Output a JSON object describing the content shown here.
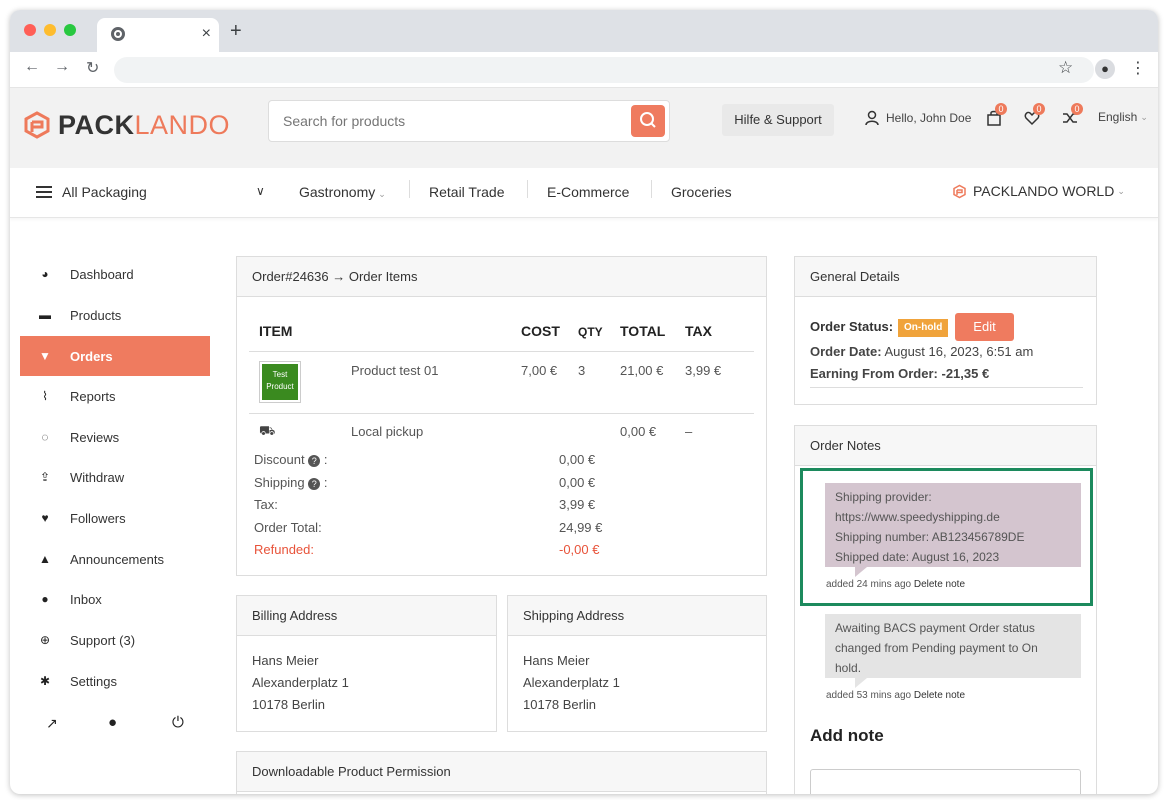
{
  "browser": {
    "new_tab": "+",
    "close_tab": "×"
  },
  "header": {
    "logo_bold": "PACK",
    "logo_light": "LANDO",
    "search_placeholder": "Search for products",
    "help_label": "Hilfe & Support",
    "greeting": "Hello, John Doe",
    "cart_count": "0",
    "wishlist_count": "0",
    "compare_count": "0",
    "language": "English"
  },
  "categories": {
    "all_label": "All Packaging",
    "items": [
      "Gastronomy",
      "Retail Trade",
      "E-Commerce",
      "Groceries"
    ],
    "world_label": "PACKLANDO WORLD"
  },
  "sidebar": {
    "items": [
      {
        "label": "Dashboard",
        "icon": "dashboard-icon"
      },
      {
        "label": "Products",
        "icon": "briefcase-icon"
      },
      {
        "label": "Orders",
        "icon": "cart-icon"
      },
      {
        "label": "Reports",
        "icon": "chart-icon"
      },
      {
        "label": "Reviews",
        "icon": "comments-icon"
      },
      {
        "label": "Withdraw",
        "icon": "upload-icon"
      },
      {
        "label": "Followers",
        "icon": "heart-icon"
      },
      {
        "label": "Announcements",
        "icon": "bell-icon"
      },
      {
        "label": "Inbox",
        "icon": "chat-icon"
      },
      {
        "label": "Support (3)",
        "icon": "lifebuoy-icon"
      },
      {
        "label": "Settings",
        "icon": "gear-icon"
      }
    ],
    "active_index": 2
  },
  "order": {
    "panel_title": "Order#24636 → Order Items",
    "columns": {
      "item": "ITEM",
      "cost": "COST",
      "qty": "QTY",
      "total": "TOTAL",
      "tax": "TAX"
    },
    "product": {
      "thumb_line1": "Test",
      "thumb_line2": "Product",
      "name": "Product test 01",
      "cost": "7,00 €",
      "qty": "3",
      "total": "21,00 €",
      "tax": "3,99 €"
    },
    "shipping": {
      "name": "Local pickup",
      "total": "0,00 €",
      "tax": "–"
    },
    "summary": [
      {
        "label": "Discount",
        "help": true,
        "value": "0,00 €"
      },
      {
        "label": "Shipping",
        "help": true,
        "value": "0,00 €"
      },
      {
        "label": "Tax:",
        "help": false,
        "value": "3,99 €"
      },
      {
        "label": "Order Total:",
        "help": false,
        "value": "24,99 €"
      }
    ],
    "refunded_label": "Refunded:",
    "refunded_value": "-0,00 €"
  },
  "billing": {
    "title": "Billing Address",
    "name": "Hans Meier",
    "street": "Alexanderplatz 1",
    "city": "10178 Berlin"
  },
  "shipping_addr": {
    "title": "Shipping Address",
    "name": "Hans Meier",
    "street": "Alexanderplatz 1",
    "city": "10178 Berlin"
  },
  "downloads": {
    "title": "Downloadable Product Permission"
  },
  "general": {
    "title": "General Details",
    "status_label": "Order Status:",
    "status_value": "On-hold",
    "edit_label": "Edit",
    "date_label": "Order Date:",
    "date_value": "August 16, 2023, 6:51 am",
    "earning_label": "Earning From Order:",
    "earning_value": "-21,35 €"
  },
  "notes": {
    "title": "Order Notes",
    "note1_lines": [
      "Shipping provider:",
      "https://www.speedyshipping.de",
      "Shipping number: AB123456789DE",
      "Shipped date: August 16, 2023"
    ],
    "note1_meta": "added 24 mins ago",
    "note2_lines": [
      "Awaiting BACS payment Order status",
      "changed from Pending payment to On",
      "hold."
    ],
    "note2_meta": "added 53 mins ago",
    "delete_label": "Delete note",
    "add_note_title": "Add note"
  },
  "colors": {
    "accent": "#ef7b5f",
    "status_badge": "#f0a33b",
    "highlight": "#1c8a5d",
    "refunded": "#e8533a"
  }
}
